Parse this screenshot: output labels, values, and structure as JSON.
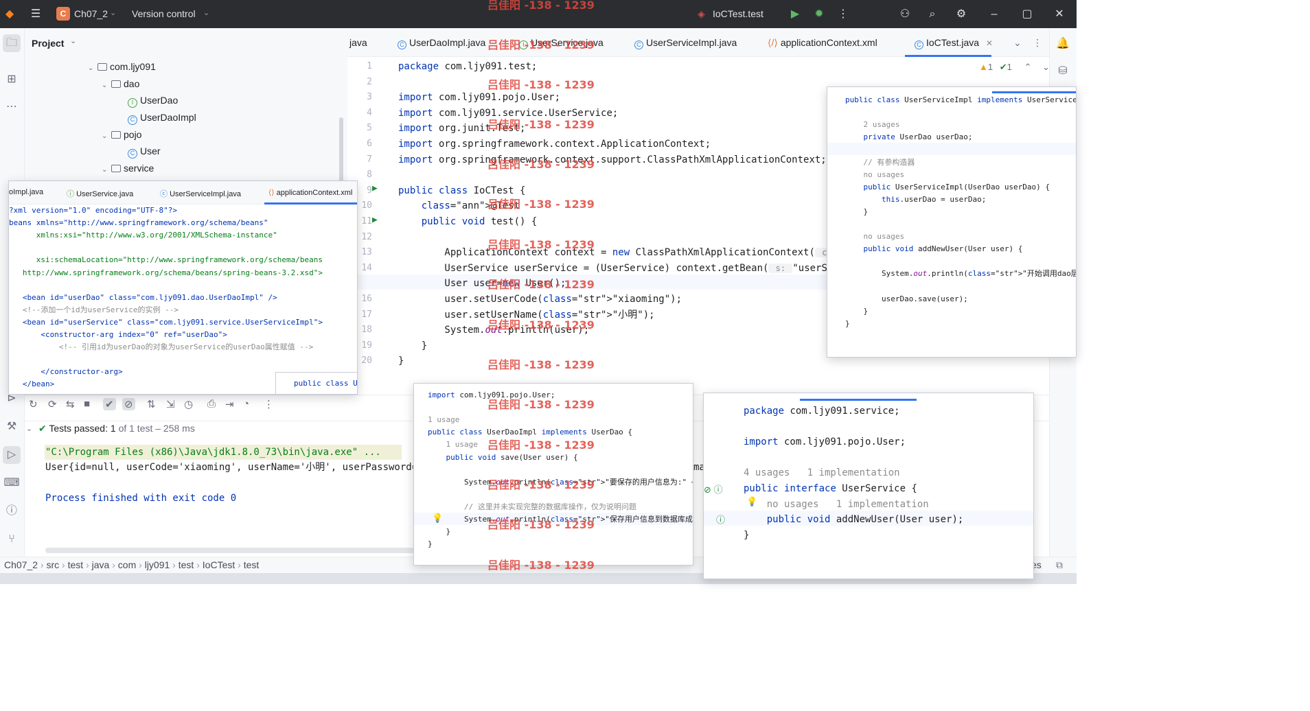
{
  "titlebar": {
    "project_initial": "C",
    "project": "Ch07_2",
    "vcs": "Version control",
    "run_config": "IoCTest.test"
  },
  "project_panel": {
    "title": "Project",
    "tree": [
      {
        "label": "com.ljy091",
        "kind": "package"
      },
      {
        "label": "dao",
        "kind": "package"
      },
      {
        "label": "UserDao",
        "kind": "interface"
      },
      {
        "label": "UserDaoImpl",
        "kind": "class"
      },
      {
        "label": "pojo",
        "kind": "package"
      },
      {
        "label": "User",
        "kind": "class"
      },
      {
        "label": "service",
        "kind": "package"
      }
    ]
  },
  "tabs": [
    {
      "label": "java"
    },
    {
      "label": "UserDaoImpl.java"
    },
    {
      "label": "UserService.java"
    },
    {
      "label": "UserServiceImpl.java"
    },
    {
      "label": "applicationContext.xml"
    },
    {
      "label": "IoCTest.java"
    }
  ],
  "inspections": {
    "warnings": "1",
    "ok": "1"
  },
  "editor": {
    "line_numbers": [
      "1",
      "2",
      "3",
      "4",
      "5",
      "6",
      "7",
      "8",
      "9",
      "10",
      "11",
      "12",
      "13",
      "14",
      "15",
      "16",
      "17",
      "18",
      "19",
      "20"
    ],
    "lines": [
      "package com.ljy091.test;",
      "",
      "import com.ljy091.pojo.User;",
      "import com.ljy091.service.UserService;",
      "import org.junit.Test;",
      "import org.springframework.context.ApplicationContext;",
      "import org.springframework.context.support.ClassPathXmlApplicationContext;",
      "",
      "public class IoCTest {",
      "    @Test",
      "    public void test() {",
      "",
      "        ApplicationContext context = new ClassPathXmlApplicationContext( conf",
      "        UserService userService = (UserService) context.getBean( s: \"userServ",
      "        User user=new User();",
      "        user.setUserCode(\"xiaoming\");",
      "        user.setUserName(\"小明\");",
      "        System.out.println(user);",
      "    }",
      "}"
    ]
  },
  "popup_xml": {
    "tabs": [
      "oImpl.java",
      "UserService.java",
      "UserServiceImpl.java",
      "applicationContext.xml"
    ],
    "lines": [
      "?xml version=\"1.0\" encoding=\"UTF-8\"?>",
      "beans xmlns=\"http://www.springframework.org/schema/beans\"",
      "      xmlns:xsi=\"http://www.w3.org/2001/XMLSchema-instance\"",
      "",
      "      xsi:schemaLocation=\"http://www.springframework.org/schema/beans",
      "   http://www.springframework.org/schema/beans/spring-beans-3.2.xsd\">",
      "",
      "   <bean id=\"userDao\" class=\"com.ljy091.dao.UserDaoImpl\" />",
      "   <!--添加一个id为userService的实例 -->",
      "   <bean id=\"userService\" class=\"com.ljy091.service.UserServiceImpl\">",
      "       <constructor-arg index=\"0\" ref=\"userDao\">",
      "           <!-- 引用id为userDao的对象为userService的userDao属性赋值 -->",
      "",
      "       </constructor-arg>",
      "   </bean>"
    ],
    "mini_tab": "public class U"
  },
  "popup_serviceimpl": {
    "lines": [
      "public class UserServiceImpl implements UserService",
      "",
      "    2 usages",
      "    private UserDao userDao;",
      "",
      "    // 有参构造器",
      "    no usages",
      "    public UserServiceImpl(UserDao userDao) {",
      "        this.userDao = userDao;",
      "    }",
      "",
      "    no usages",
      "    public void addNewUser(User user) {",
      "",
      "        System.out.println(\"开始调用dao层保存用户信息\");",
      "",
      "        userDao.save(user);",
      "    }",
      "}"
    ]
  },
  "popup_daoimpl": {
    "lines": [
      "import com.ljy091.pojo.User;",
      "",
      "1 usage",
      "public class UserDaoImpl implements UserDao {",
      "    1 usage",
      "    public void save(User user) {",
      "",
      "        System.out.println(\"要保存的用户信息为:\" + user);",
      "",
      "        // 这里并未实现完整的数据库操作，仅为说明问题",
      "        System.out.println(\"保存用户信息到数据库成功!!!\");",
      "    }",
      "}"
    ]
  },
  "popup_service": {
    "lines": [
      "package com.ljy091.service;",
      "",
      "import com.ljy091.pojo.User;",
      "",
      "4 usages   1 implementation",
      "public interface UserService {",
      "    no usages   1 implementation",
      "    public void addNewUser(User user);",
      "}"
    ]
  },
  "run": {
    "status": "Tests passed:",
    "count": "1",
    "detail": "of 1 test – 258 ms",
    "out1": "\"C:\\Program Files (x86)\\Java\\jdk1.8.0_73\\bin\\java.exe\" ...",
    "out2": "User{id=null, userCode='xiaoming', userName='小明', userPassword='",
    "out3": "Process finished with exit code 0",
    "right_fragment": "ma"
  },
  "breadcrumb": [
    "Ch07_2",
    "src",
    "test",
    "java",
    "com",
    "ljy091",
    "test",
    "IoCTest",
    "test"
  ],
  "breadcrumb_right": "es",
  "watermark": "吕佳阳 -138 - 1239",
  "colors": {
    "accent": "#3574f0",
    "keyword": "#0033b3",
    "string": "#067d17",
    "pass": "#208a3c"
  }
}
